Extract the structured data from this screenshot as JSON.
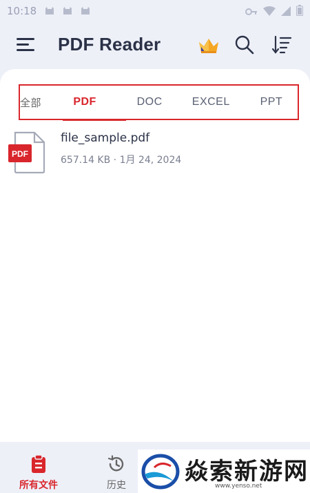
{
  "status_bar": {
    "time": "10:18"
  },
  "app_bar": {
    "title": "PDF Reader"
  },
  "tabs": [
    {
      "label": "全部"
    },
    {
      "label": "PDF",
      "selected": true
    },
    {
      "label": "DOC"
    },
    {
      "label": "EXCEL"
    },
    {
      "label": "PPT"
    }
  ],
  "files": [
    {
      "name": "file_sample.pdf",
      "meta": "657.14 KB · 1月 24, 2024",
      "type_badge": "PDF"
    }
  ],
  "bottom_nav": {
    "all_files_label": "所有文件",
    "history_label": "历史"
  },
  "watermark": {
    "text": "焱索新游网",
    "url": "www.yenso.net"
  },
  "colors": {
    "accent": "#d9262c",
    "background": "#eef0f8",
    "title": "#2b3247"
  }
}
